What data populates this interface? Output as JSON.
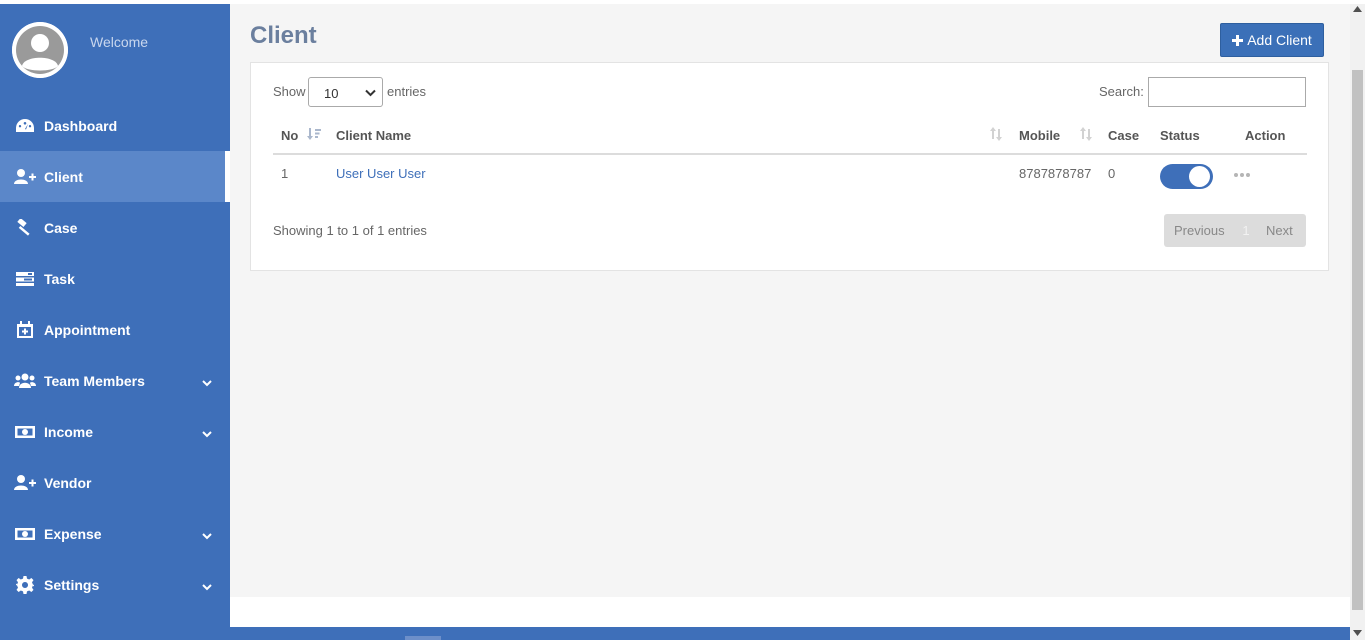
{
  "sidebar": {
    "welcome": "Welcome",
    "items": [
      {
        "label": "Dashboard",
        "icon": "dashboard-icon"
      },
      {
        "label": "Client",
        "icon": "user-plus-icon",
        "active": true
      },
      {
        "label": "Case",
        "icon": "gavel-icon"
      },
      {
        "label": "Task",
        "icon": "tasks-icon"
      },
      {
        "label": "Appointment",
        "icon": "calendar-plus-icon"
      },
      {
        "label": "Team Members",
        "icon": "users-icon",
        "has_submenu": true
      },
      {
        "label": "Income",
        "icon": "money-icon",
        "has_submenu": true
      },
      {
        "label": "Vendor",
        "icon": "user-plus-icon"
      },
      {
        "label": "Expense",
        "icon": "money-icon",
        "has_submenu": true
      },
      {
        "label": "Settings",
        "icon": "gear-icon",
        "has_submenu": true
      }
    ]
  },
  "page": {
    "title": "Client",
    "add_button": "Add Client"
  },
  "table": {
    "show_label": "Show",
    "entries_value": "10",
    "entries_label": "entries",
    "search_label": "Search:",
    "search_value": "",
    "columns": [
      "No",
      "Client Name",
      "Mobile",
      "Case",
      "Status",
      "Action"
    ],
    "rows": [
      {
        "no": "1",
        "name": "User User User",
        "mobile": "8787878787",
        "case": "0",
        "status_on": true
      }
    ],
    "info": "Showing 1 to 1 of 1 entries",
    "pagination": {
      "previous": "Previous",
      "page": "1",
      "next": "Next"
    }
  },
  "colors": {
    "sidebar": "#3e6fb9",
    "accent": "#3b70b8",
    "background": "#f5f5f5"
  }
}
